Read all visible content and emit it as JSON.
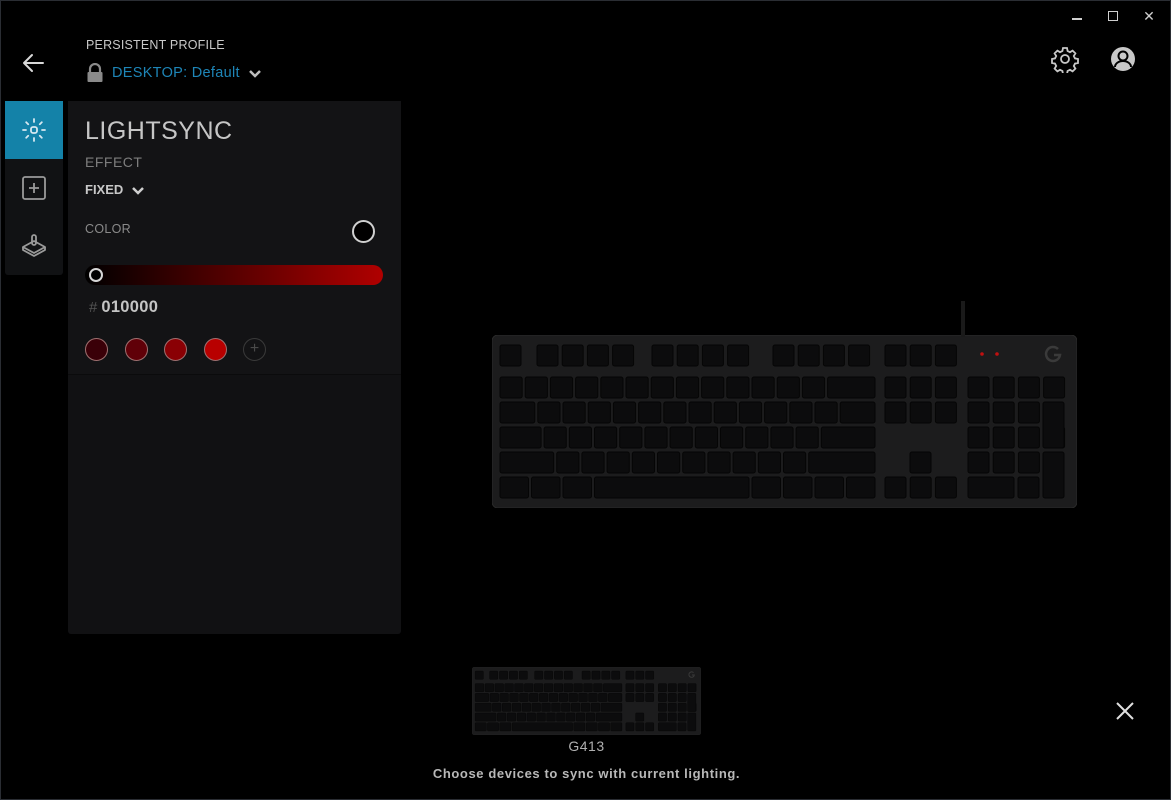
{
  "window_controls": {
    "minimize": "minimize",
    "maximize": "maximize",
    "close": "✕"
  },
  "header": {
    "back_icon": "arrow-left-icon",
    "profile_label": "PERSISTENT PROFILE",
    "profile_name": "DESKTOP: Default",
    "settings_icon": "gear-icon",
    "account_icon": "user-icon"
  },
  "sidebar": {
    "items": [
      {
        "name": "lightsync",
        "icon": "sun-icon",
        "active": true
      },
      {
        "name": "assignments",
        "icon": "plus-square-icon",
        "active": false
      },
      {
        "name": "game-mode",
        "icon": "joystick-icon",
        "active": false
      }
    ]
  },
  "panel": {
    "title": "LIGHTSYNC",
    "effect_label": "EFFECT",
    "effect_value": "FIXED",
    "color_label": "COLOR",
    "current_color": "#010000",
    "slider": {
      "from": "#000000",
      "to": "#b00000",
      "value_fraction": 0.0
    },
    "hex_prefix": "#",
    "hex_value": "010000",
    "swatches": [
      "#3a0008",
      "#600008",
      "#8a0004",
      "#b80000"
    ],
    "add_swatch": "+"
  },
  "devices": {
    "selected": "G413",
    "indicator_colors": {
      "led": "#c01010",
      "accent": "#1482a8"
    }
  },
  "footer": {
    "device_label": "G413",
    "sync_message": "Choose devices to sync with current lighting.",
    "dismiss_icon": "close-icon"
  }
}
